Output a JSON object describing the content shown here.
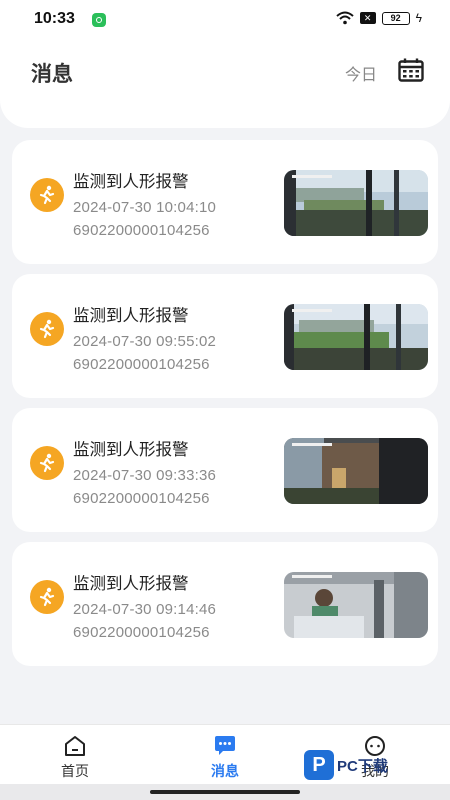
{
  "status_bar": {
    "time": "10:33",
    "battery": "92"
  },
  "header": {
    "title": "消息",
    "today_label": "今日"
  },
  "messages": [
    {
      "title": "监测到人形报警",
      "time": "2024-07-30 10:04:10",
      "device_id": "6902200000104256"
    },
    {
      "title": "监测到人形报警",
      "time": "2024-07-30 09:55:02",
      "device_id": "6902200000104256"
    },
    {
      "title": "监测到人形报警",
      "time": "2024-07-30 09:33:36",
      "device_id": "6902200000104256"
    },
    {
      "title": "监测到人形报警",
      "time": "2024-07-30 09:14:46",
      "device_id": "6902200000104256"
    }
  ],
  "tabbar": {
    "home_label": "首页",
    "messages_label": "消息",
    "mine_label": "我的"
  },
  "watermark": {
    "text": "PC下载"
  },
  "colors": {
    "accent": "#2b7bf0",
    "alarm_icon": "#f5a623"
  },
  "icons": [
    "calendar-icon",
    "person-running-icon",
    "home-icon",
    "chat-bubble-icon",
    "profile-icon",
    "wifi-icon"
  ]
}
